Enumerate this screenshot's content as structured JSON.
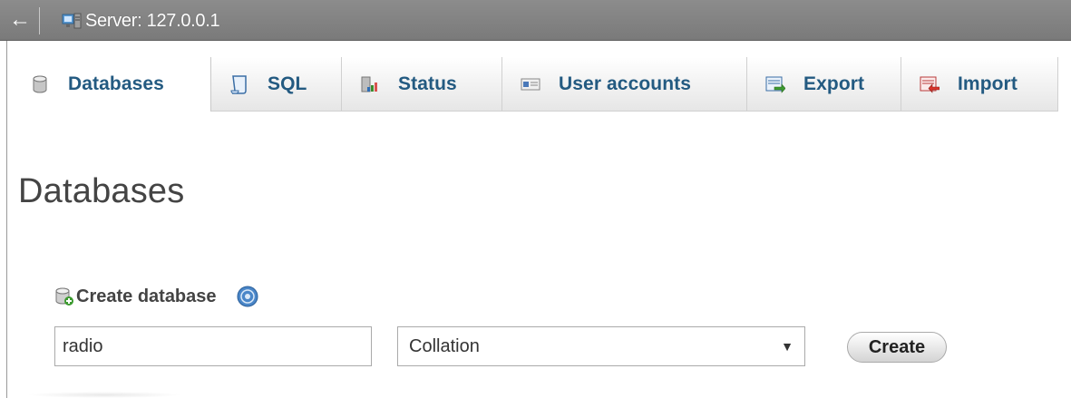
{
  "topbar": {
    "back_label": "←",
    "server_label": "Server: 127.0.0.1",
    "server_icon": "server-icon"
  },
  "tabs": [
    {
      "label": "Databases",
      "icon": "database-icon",
      "active": true
    },
    {
      "label": "SQL",
      "icon": "sql-icon",
      "active": false
    },
    {
      "label": "Status",
      "icon": "status-chart-icon",
      "active": false
    },
    {
      "label": "User accounts",
      "icon": "user-accounts-icon",
      "active": false
    },
    {
      "label": "Export",
      "icon": "export-icon",
      "active": false
    },
    {
      "label": "Import",
      "icon": "import-icon",
      "active": false
    }
  ],
  "page": {
    "title": "Databases"
  },
  "create_database": {
    "heading": "Create database",
    "name_value": "radio",
    "collation_value": "Collation",
    "select_arrow": "▼",
    "create_label": "Create"
  },
  "colors": {
    "tab_text": "#235a81",
    "topbar": "#858585"
  }
}
